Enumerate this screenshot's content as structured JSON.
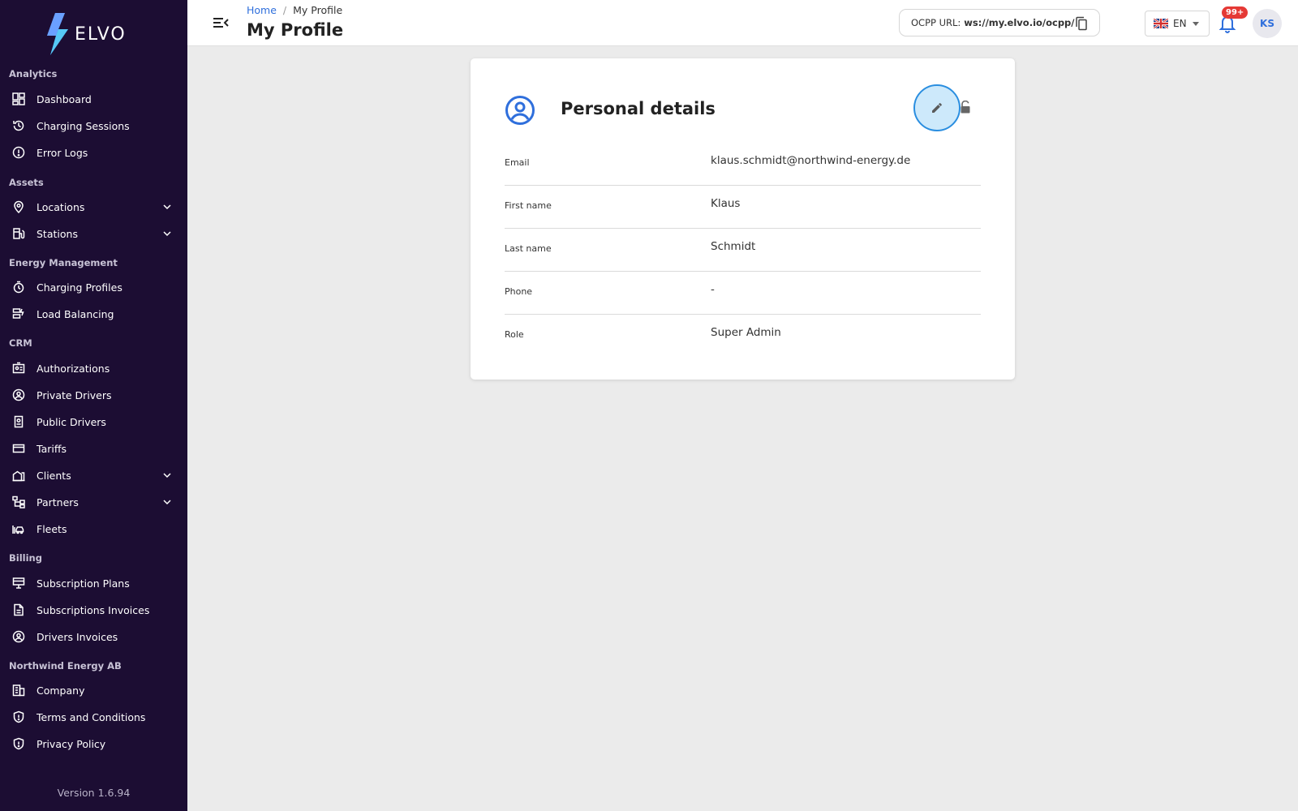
{
  "brand": {
    "name": "ELVO",
    "accent": "#2f6fdc",
    "sidebar_bg": "#1c0d33"
  },
  "sidebar": {
    "sections": [
      {
        "title": "Analytics",
        "items": [
          {
            "label": "Dashboard",
            "icon": "dashboard-icon"
          },
          {
            "label": "Charging Sessions",
            "icon": "history-icon"
          },
          {
            "label": "Error Logs",
            "icon": "alert-circle-icon"
          }
        ]
      },
      {
        "title": "Assets",
        "items": [
          {
            "label": "Locations",
            "icon": "location-pin-icon"
          },
          {
            "label": "Stations",
            "icon": "ev-station-icon"
          }
        ]
      },
      {
        "title": "Energy Management",
        "items": [
          {
            "label": "Charging Profiles",
            "icon": "timer-icon"
          },
          {
            "label": "Load Balancing",
            "icon": "load-balance-icon"
          }
        ]
      },
      {
        "title": "CRM",
        "items": [
          {
            "label": "Authorizations",
            "icon": "id-card-icon"
          },
          {
            "label": "Private Drivers",
            "icon": "user-circle-icon"
          },
          {
            "label": "Public Drivers",
            "icon": "badge-icon"
          },
          {
            "label": "Tariffs",
            "icon": "credit-card-icon"
          },
          {
            "label": "Clients",
            "icon": "building-icon"
          },
          {
            "label": "Partners",
            "icon": "hierarchy-icon"
          },
          {
            "label": "Fleets",
            "icon": "car-icon"
          }
        ]
      },
      {
        "title": "Billing",
        "items": [
          {
            "label": "Subscription Plans",
            "icon": "monitor-icon"
          },
          {
            "label": "Subscriptions Invoices",
            "icon": "document-icon"
          },
          {
            "label": "Drivers Invoices",
            "icon": "user-circle-icon"
          }
        ]
      },
      {
        "title": "Northwind Energy AB",
        "items": [
          {
            "label": "Company",
            "icon": "company-icon"
          },
          {
            "label": "Terms and Conditions",
            "icon": "shield-icon"
          },
          {
            "label": "Privacy Policy",
            "icon": "shield-icon"
          }
        ]
      }
    ],
    "version": "Version 1.6.94"
  },
  "header": {
    "breadcrumb": {
      "home": "Home",
      "separator": "/",
      "current": "My Profile"
    },
    "title": "My Profile",
    "ocpp": {
      "label": "OCPP URL:",
      "value": "ws://my.elvo.io/ocpp/"
    },
    "language": "EN",
    "notifications_badge": "99+",
    "avatar_initials": "KS"
  },
  "profile": {
    "title": "Personal details",
    "fields": [
      {
        "label": "Email",
        "value": "klaus.schmidt@northwind-energy.de"
      },
      {
        "label": "First name",
        "value": "Klaus"
      },
      {
        "label": "Last name",
        "value": "Schmidt"
      },
      {
        "label": "Phone",
        "value": "-"
      },
      {
        "label": "Role",
        "value": "Super Admin"
      }
    ]
  }
}
